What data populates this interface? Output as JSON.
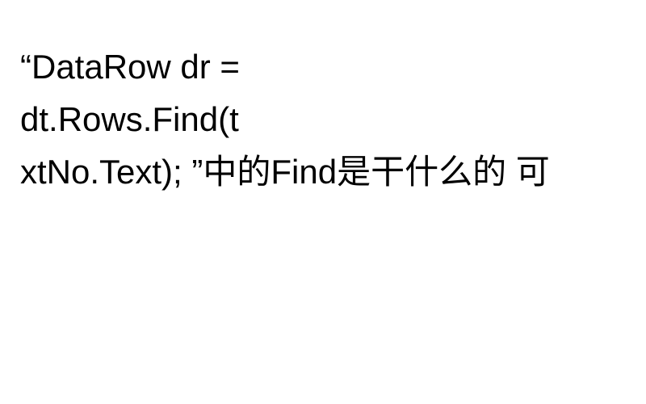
{
  "content": {
    "line1": "“DataRow dr =",
    "line2": "dt.Rows.Find(t",
    "line3": "xtNo.Text); ”中的Find是干什么的 可"
  }
}
